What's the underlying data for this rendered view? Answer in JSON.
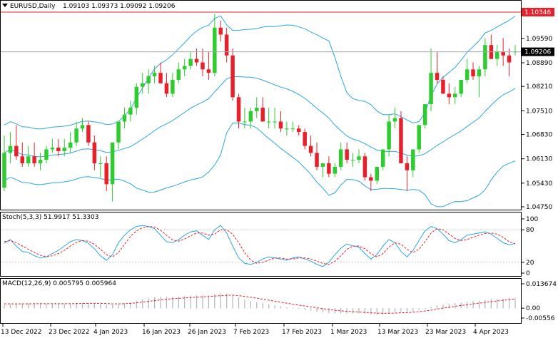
{
  "header": {
    "title": "EURUSD,Daily",
    "ohlc": "1.09103 1.09373 1.09092 1.09206"
  },
  "price_axis": {
    "levels": [
      "1.10346",
      "1.09590",
      "1.09206",
      "1.08890",
      "1.08210",
      "1.07510",
      "1.06830",
      "1.06130",
      "1.05430",
      "1.04750"
    ],
    "highlight_level": "1.10346",
    "current_price": "1.09206"
  },
  "stoch": {
    "label": "Stoch(5,3,3) 51.9917 51.3303",
    "levels": [
      "100",
      "80",
      "20",
      "0"
    ]
  },
  "macd": {
    "label": "MACD(12,26,9) 0.005795 0.005964",
    "levels": [
      "0.013674",
      "0.00",
      "-0.00556"
    ]
  },
  "time_axis": {
    "labels": [
      "13 Dec 2022",
      "23 Dec 2022",
      "4 Jan 2023",
      "16 Jan 2023",
      "26 Jan 2023",
      "7 Feb 2023",
      "17 Feb 2023",
      "1 Mar 2023",
      "13 Mar 2023",
      "23 Mar 2023",
      "4 Apr 2023"
    ]
  },
  "colors": {
    "bull": "#2ecc2e",
    "bear": "#e8202a",
    "bands": "#2aa7e0",
    "signal": "#e8202a",
    "highlight": "#e8202a"
  },
  "chart_data": [
    {
      "type": "candlestick",
      "series": "EURUSD Daily",
      "x": [
        "2022-12-13",
        "2022-12-14",
        "2022-12-15",
        "2022-12-16",
        "2022-12-19",
        "2022-12-20",
        "2022-12-21",
        "2022-12-22",
        "2022-12-23",
        "2022-12-26",
        "2022-12-27",
        "2022-12-28",
        "2022-12-29",
        "2022-12-30",
        "2023-01-02",
        "2023-01-03",
        "2023-01-04",
        "2023-01-05",
        "2023-01-06",
        "2023-01-09",
        "2023-01-10",
        "2023-01-11",
        "2023-01-12",
        "2023-01-13",
        "2023-01-16",
        "2023-01-17",
        "2023-01-18",
        "2023-01-19",
        "2023-01-20",
        "2023-01-23",
        "2023-01-24",
        "2023-01-25",
        "2023-01-26",
        "2023-01-27",
        "2023-01-30",
        "2023-01-31",
        "2023-02-01",
        "2023-02-02",
        "2023-02-03",
        "2023-02-06",
        "2023-02-07",
        "2023-02-08",
        "2023-02-09",
        "2023-02-10",
        "2023-02-13",
        "2023-02-14",
        "2023-02-15",
        "2023-02-16",
        "2023-02-17",
        "2023-02-20",
        "2023-02-21",
        "2023-02-22",
        "2023-02-23",
        "2023-02-24",
        "2023-02-27",
        "2023-02-28",
        "2023-03-01",
        "2023-03-02",
        "2023-03-03",
        "2023-03-06",
        "2023-03-07",
        "2023-03-08",
        "2023-03-09",
        "2023-03-10",
        "2023-03-13",
        "2023-03-14",
        "2023-03-15",
        "2023-03-16",
        "2023-03-17",
        "2023-03-20",
        "2023-03-21",
        "2023-03-22",
        "2023-03-23",
        "2023-03-24",
        "2023-03-27",
        "2023-03-28",
        "2023-03-29",
        "2023-03-30",
        "2023-03-31",
        "2023-04-03",
        "2023-04-04",
        "2023-04-05",
        "2023-04-06",
        "2023-04-07",
        "2023-04-10",
        "2023-04-11"
      ],
      "open": [
        1.053,
        1.063,
        1.065,
        1.062,
        1.06,
        1.062,
        1.06,
        1.061,
        1.064,
        1.0645,
        1.0635,
        1.0645,
        1.066,
        1.07,
        1.071,
        1.066,
        1.06,
        1.06,
        1.054,
        1.066,
        1.072,
        1.074,
        1.076,
        1.082,
        1.083,
        1.085,
        1.086,
        1.083,
        1.08,
        1.084,
        1.087,
        1.088,
        1.09,
        1.089,
        1.087,
        1.086,
        1.099,
        1.097,
        1.091,
        1.079,
        1.072,
        1.072,
        1.075,
        1.076,
        1.072,
        1.072,
        1.072,
        1.07,
        1.07,
        1.07,
        1.069,
        1.065,
        1.063,
        1.059,
        1.06,
        1.057,
        1.059,
        1.064,
        1.061,
        1.061,
        1.062,
        1.056,
        1.055,
        1.059,
        1.064,
        1.072,
        1.073,
        1.06,
        1.058,
        1.064,
        1.071,
        1.077,
        1.086,
        1.084,
        1.08,
        1.079,
        1.08,
        1.084,
        1.087,
        1.085,
        1.087,
        1.094,
        1.09,
        1.092,
        1.091,
        1.0921
      ],
      "high": [
        1.068,
        1.069,
        1.071,
        1.066,
        1.065,
        1.066,
        1.063,
        1.065,
        1.067,
        1.067,
        1.067,
        1.069,
        1.072,
        1.073,
        1.072,
        1.068,
        1.062,
        1.062,
        1.056,
        1.07,
        1.076,
        1.078,
        1.083,
        1.086,
        1.087,
        1.088,
        1.089,
        1.086,
        1.086,
        1.089,
        1.09,
        1.092,
        1.093,
        1.093,
        1.092,
        1.103,
        1.101,
        1.099,
        1.093,
        1.08,
        1.076,
        1.076,
        1.079,
        1.079,
        1.076,
        1.076,
        1.075,
        1.072,
        1.072,
        1.071,
        1.07,
        1.068,
        1.066,
        1.06,
        1.062,
        1.06,
        1.066,
        1.066,
        1.063,
        1.064,
        1.063,
        1.057,
        1.057,
        1.062,
        1.074,
        1.076,
        1.075,
        1.062,
        1.06,
        1.066,
        1.077,
        1.093,
        1.092,
        1.085,
        1.083,
        1.082,
        1.084,
        1.09,
        1.089,
        1.088,
        1.096,
        1.097,
        1.094,
        1.096,
        1.093,
        1.094
      ],
      "low": [
        1.052,
        1.06,
        1.061,
        1.059,
        1.059,
        1.059,
        1.058,
        1.06,
        1.063,
        1.062,
        1.062,
        1.063,
        1.065,
        1.069,
        1.065,
        1.058,
        1.056,
        1.052,
        1.049,
        1.064,
        1.07,
        1.072,
        1.074,
        1.08,
        1.08,
        1.083,
        1.083,
        1.079,
        1.079,
        1.083,
        1.085,
        1.087,
        1.088,
        1.085,
        1.084,
        1.085,
        1.095,
        1.089,
        1.078,
        1.07,
        1.07,
        1.07,
        1.073,
        1.072,
        1.07,
        1.07,
        1.069,
        1.068,
        1.069,
        1.068,
        1.064,
        1.062,
        1.058,
        1.056,
        1.056,
        1.056,
        1.058,
        1.06,
        1.059,
        1.06,
        1.055,
        1.052,
        1.054,
        1.058,
        1.062,
        1.07,
        1.06,
        1.052,
        1.056,
        1.063,
        1.07,
        1.075,
        1.083,
        1.08,
        1.077,
        1.077,
        1.079,
        1.083,
        1.084,
        1.079,
        1.085,
        1.09,
        1.088,
        1.088,
        1.085,
        1.091
      ],
      "close": [
        1.063,
        1.065,
        1.062,
        1.06,
        1.062,
        1.06,
        1.061,
        1.064,
        1.0645,
        1.0635,
        1.0645,
        1.066,
        1.07,
        1.071,
        1.066,
        1.06,
        1.06,
        1.054,
        1.066,
        1.072,
        1.074,
        1.076,
        1.082,
        1.083,
        1.085,
        1.086,
        1.083,
        1.08,
        1.084,
        1.087,
        1.088,
        1.09,
        1.089,
        1.087,
        1.086,
        1.099,
        1.097,
        1.091,
        1.079,
        1.072,
        1.072,
        1.075,
        1.076,
        1.072,
        1.072,
        1.072,
        1.07,
        1.07,
        1.07,
        1.069,
        1.065,
        1.063,
        1.059,
        1.06,
        1.057,
        1.059,
        1.064,
        1.061,
        1.061,
        1.062,
        1.056,
        1.055,
        1.059,
        1.064,
        1.072,
        1.073,
        1.06,
        1.058,
        1.064,
        1.071,
        1.077,
        1.086,
        1.084,
        1.08,
        1.079,
        1.08,
        1.084,
        1.087,
        1.085,
        1.087,
        1.094,
        1.09,
        1.092,
        1.091,
        1.089,
        1.0921
      ]
    },
    {
      "type": "line",
      "series": "Stoch(5,3,3)",
      "ylim": [
        0,
        100
      ],
      "main": [
        55,
        62,
        50,
        40,
        38,
        32,
        28,
        30,
        36,
        42,
        50,
        58,
        62,
        60,
        55,
        45,
        32,
        24,
        34,
        56,
        70,
        80,
        86,
        88,
        86,
        82,
        70,
        58,
        56,
        62,
        70,
        76,
        78,
        70,
        62,
        80,
        88,
        74,
        50,
        28,
        18,
        16,
        20,
        26,
        30,
        28,
        26,
        24,
        28,
        30,
        26,
        22,
        16,
        12,
        20,
        34,
        46,
        54,
        50,
        48,
        36,
        26,
        34,
        50,
        62,
        56,
        40,
        30,
        42,
        60,
        78,
        86,
        82,
        72,
        60,
        56,
        62,
        70,
        72,
        74,
        76,
        72,
        64,
        56,
        52,
        55
      ],
      "signal": [
        58,
        60,
        56,
        50,
        44,
        38,
        33,
        30,
        32,
        36,
        42,
        50,
        57,
        60,
        59,
        53,
        44,
        34,
        30,
        38,
        53,
        68,
        78,
        84,
        86,
        85,
        79,
        70,
        61,
        59,
        63,
        69,
        74,
        74,
        70,
        72,
        80,
        80,
        72,
        56,
        38,
        24,
        18,
        20,
        24,
        28,
        28,
        26,
        26,
        28,
        28,
        26,
        22,
        18,
        16,
        22,
        32,
        44,
        50,
        50,
        45,
        36,
        30,
        36,
        48,
        56,
        53,
        44,
        38,
        44,
        58,
        74,
        82,
        80,
        72,
        64,
        60,
        62,
        66,
        70,
        73,
        74,
        72,
        66,
        58,
        54
      ]
    },
    {
      "type": "histogram",
      "series": "MACD(12,26,9)",
      "ylim": [
        -0.00556,
        0.013674
      ],
      "main": [
        0.002,
        0.0022,
        0.0024,
        0.0025,
        0.0026,
        0.0026,
        0.0025,
        0.0025,
        0.0025,
        0.0025,
        0.0025,
        0.0026,
        0.0028,
        0.003,
        0.003,
        0.0028,
        0.0025,
        0.002,
        0.0018,
        0.0022,
        0.0028,
        0.0034,
        0.0042,
        0.005,
        0.0056,
        0.0062,
        0.0064,
        0.0064,
        0.0064,
        0.0066,
        0.0068,
        0.007,
        0.0072,
        0.0072,
        0.007,
        0.0078,
        0.0082,
        0.0082,
        0.0074,
        0.006,
        0.0048,
        0.004,
        0.0034,
        0.0028,
        0.0022,
        0.0016,
        0.001,
        0.0005,
        0.0001,
        -0.0003,
        -0.0008,
        -0.0012,
        -0.0018,
        -0.0022,
        -0.0026,
        -0.0028,
        -0.0028,
        -0.0028,
        -0.0028,
        -0.0028,
        -0.003,
        -0.0034,
        -0.0036,
        -0.0034,
        -0.0028,
        -0.0022,
        -0.002,
        -0.002,
        -0.0016,
        -0.001,
        -0.0002,
        0.0008,
        0.0016,
        0.002,
        0.0024,
        0.0028,
        0.0032,
        0.0036,
        0.004,
        0.0042,
        0.0046,
        0.005,
        0.0052,
        0.0054,
        0.0056,
        0.0058
      ],
      "signal": [
        0.0024,
        0.0024,
        0.0024,
        0.0024,
        0.0024,
        0.0025,
        0.0025,
        0.0025,
        0.0025,
        0.0025,
        0.0025,
        0.0025,
        0.0026,
        0.0026,
        0.0027,
        0.0027,
        0.0027,
        0.0026,
        0.0024,
        0.0024,
        0.0025,
        0.0027,
        0.003,
        0.0034,
        0.0038,
        0.0042,
        0.0046,
        0.005,
        0.0053,
        0.0055,
        0.0058,
        0.006,
        0.0062,
        0.0064,
        0.0065,
        0.0068,
        0.007,
        0.0072,
        0.0073,
        0.007,
        0.0066,
        0.0061,
        0.0056,
        0.005,
        0.0045,
        0.0039,
        0.0033,
        0.0028,
        0.0022,
        0.0017,
        0.0012,
        0.0007,
        0.0002,
        -0.0003,
        -0.0008,
        -0.0012,
        -0.0015,
        -0.0018,
        -0.002,
        -0.0022,
        -0.0024,
        -0.0026,
        -0.0028,
        -0.0029,
        -0.0029,
        -0.0028,
        -0.0026,
        -0.0025,
        -0.0023,
        -0.002,
        -0.0016,
        -0.0011,
        -0.0005,
        0.0,
        0.0005,
        0.001,
        0.0015,
        0.0019,
        0.0024,
        0.0028,
        0.0032,
        0.0036,
        0.004,
        0.0044,
        0.0048,
        0.0051
      ]
    }
  ]
}
